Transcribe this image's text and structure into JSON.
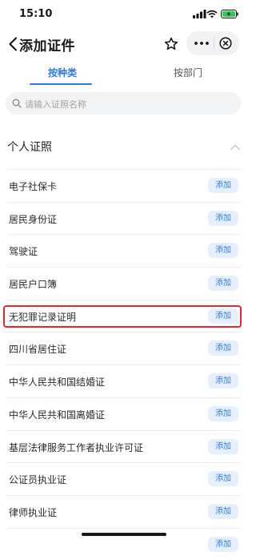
{
  "status_bar": {
    "time": "15:10"
  },
  "nav": {
    "title": "添加证件"
  },
  "tabs": [
    {
      "label": "按种类",
      "active": true
    },
    {
      "label": "按部门",
      "active": false
    }
  ],
  "search": {
    "placeholder": "请输入证照名称"
  },
  "section": {
    "title": "个人证照"
  },
  "items": [
    {
      "label": "电子社保卡",
      "button": "添加"
    },
    {
      "label": "居民身份证",
      "button": "添加"
    },
    {
      "label": "驾驶证",
      "button": "添加"
    },
    {
      "label": "居民户口簿",
      "button": "添加"
    },
    {
      "label": "无犯罪记录证明",
      "button": "添加"
    },
    {
      "label": "四川省居住证",
      "button": "添加"
    },
    {
      "label": "中华人民共和国结婚证",
      "button": "添加"
    },
    {
      "label": "中华人民共和国离婚证",
      "button": "添加"
    },
    {
      "label": "基层法律服务工作者执业许可证",
      "button": "添加"
    },
    {
      "label": "公证员执业证",
      "button": "添加"
    },
    {
      "label": "律师执业证",
      "button": "添加"
    },
    {
      "label": "",
      "button": "添加"
    }
  ],
  "colors": {
    "accent": "#2f7ae5",
    "highlight": "#e8262b",
    "battery": "#34c759"
  }
}
